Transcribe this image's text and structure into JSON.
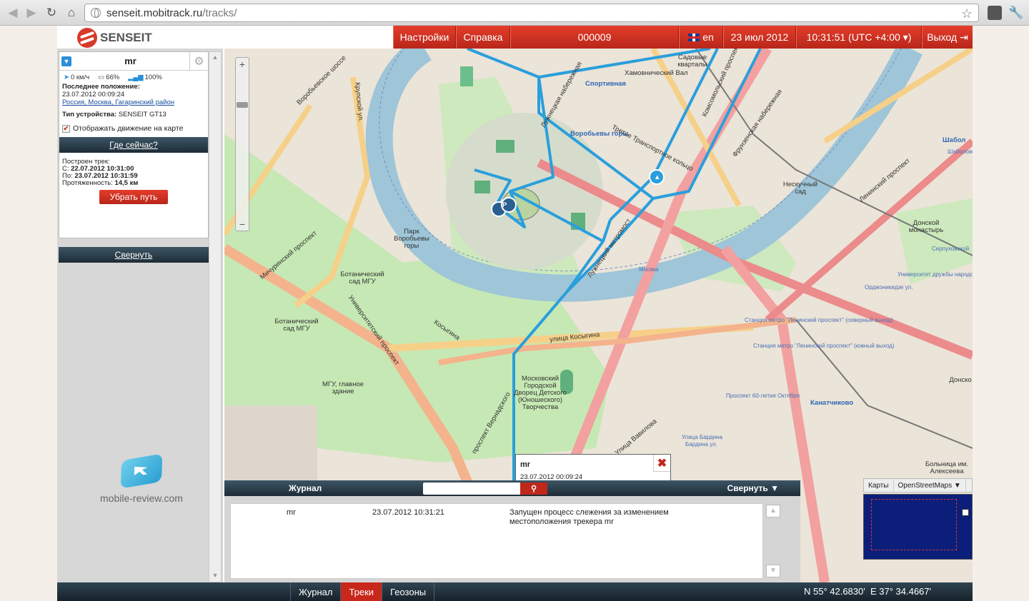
{
  "browser": {
    "url_host": "senseit.mobitrack.ru",
    "url_path": "/tracks/"
  },
  "app": {
    "logo_text": "SENSEIT",
    "nav": {
      "settings": "Настройки",
      "help": "Справка",
      "device_id": "000009",
      "lang": "en",
      "date": "23 июл 2012",
      "time": "10:31:51 (UTC +4:00 ▾)",
      "exit": "Выход"
    }
  },
  "tracker": {
    "name": "mr",
    "speed": "0 км/ч",
    "battery": "66%",
    "signal": "100%",
    "last_position_label": "Последнее положение:",
    "last_position_time": "23.07.2012 00:09:24",
    "last_position_address": "Россия, Москва, Гагаринский район",
    "device_type_label": "Тип устройства:",
    "device_type": "SENSEIT GT13",
    "show_motion_label": "Отображать движение на карте",
    "where_now": "Где сейчас?",
    "track_built_label": "Построен трек:",
    "from_label": "С:",
    "from_value": "22.07.2012 10:31:00",
    "to_label": "По:",
    "to_value": "23.07.2012 10:31:59",
    "length_label": "Протяженность:",
    "length_value": "14,5 км",
    "remove_path": "Убрать путь",
    "collapse": "Свернуть"
  },
  "watermark": {
    "text": "mobile-review.com"
  },
  "map": {
    "labels": [
      "Спортивная",
      "Воробьевы горы",
      "Третье Транспортное кольцо",
      "Лужнецкий метромост",
      "Парк Воробьевы горы",
      "Ботанический сад МГУ",
      "Ботанический сад МГУ",
      "улица Косыгина",
      "Мичуринский проспект",
      "Университетский проспект",
      "МГУ, главное здание",
      "Московский Городской Дворец Детского (Юношеского) Творчества",
      "Нескучный сад",
      "Донской монастырь",
      "Канатчиково",
      "Больница им. Алексеева",
      "Фрунзенская набережная",
      "Комсомольский проспект",
      "Ленинский проспект",
      "Университет дружбы народов",
      "Орджоникидзе ул.",
      "Станция метро \"Ленинский проспект\" (северный выход)",
      "Станция метро \"Ленинский проспект\" (южный выход)",
      "Проспект 60-летия Октября",
      "Улица Вавилова",
      "проспект Вернадского",
      "Москва",
      "Шабол",
      "Шаболовская",
      "Серпуховской",
      "Донско",
      "Лужнецкая набережная",
      "Хамовнический Вал",
      "Воробьевское шоссе",
      "Крупской ул.",
      "Косыгина",
      "Улица Бардина",
      "Бардина ул.",
      "Садовые кварталы"
    ],
    "popup": {
      "title": "mr",
      "time": "23.07.2012 00:09:24"
    },
    "mini_tabs": {
      "maps": "Карты",
      "source": "OpenStreetMaps"
    },
    "colors": {
      "track": "#2a9fdc",
      "river": "#9ec5d8",
      "park": "#c6e8b4"
    }
  },
  "journal": {
    "title": "Журнал",
    "collapse": "Свернуть",
    "entries": [
      {
        "name": "mr",
        "time": "23.07.2012 10:31:21",
        "message": "Запущен процесс слежения за изменением местоположения трекера mr"
      }
    ]
  },
  "bottom": {
    "tabs": [
      "Журнал",
      "Треки",
      "Геозоны"
    ],
    "active_tab": "Треки",
    "lat": "N 55° 42.6830'",
    "lon": "E 37° 34.4667'"
  }
}
